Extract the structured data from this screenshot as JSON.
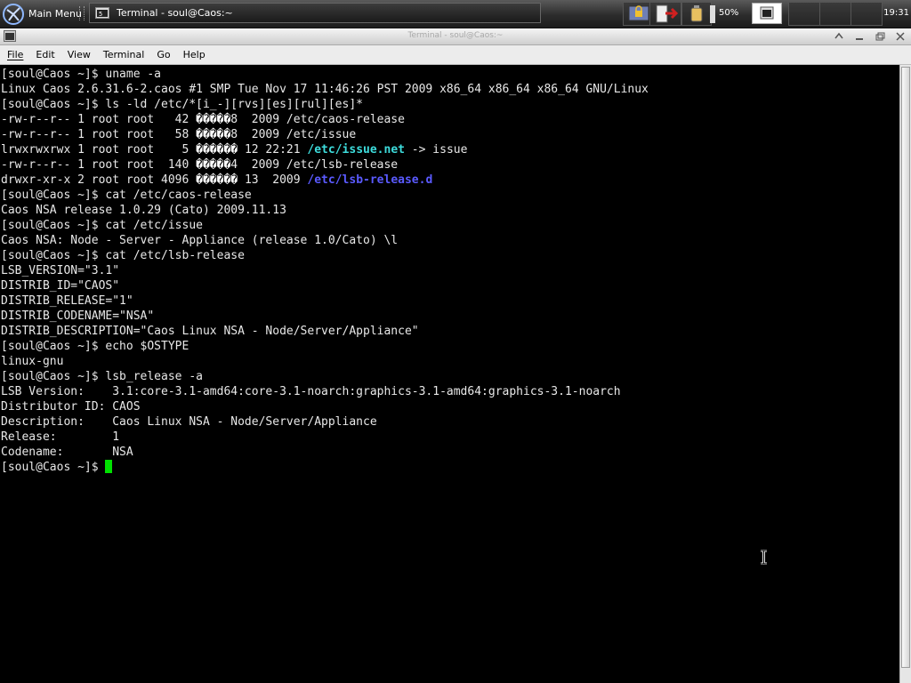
{
  "panel": {
    "main_menu_label": "Main Menu",
    "task_title": "Terminal - soul@Caos:~",
    "battery_percent": "50%",
    "clock": "19:31",
    "icons": [
      "caos-logo-icon",
      "terminal-icon",
      "lock-icon",
      "exit-icon",
      "battery-icon",
      "terminal-launcher-icon"
    ]
  },
  "window": {
    "title": "Terminal - soul@Caos:~",
    "buttons": [
      "shade",
      "minimize",
      "maximize",
      "close"
    ]
  },
  "menubar": {
    "items": [
      {
        "label": "File",
        "mnemonic": "F"
      },
      {
        "label": "Edit",
        "mnemonic": "E"
      },
      {
        "label": "View",
        "mnemonic": "V"
      },
      {
        "label": "Terminal",
        "mnemonic": "T"
      },
      {
        "label": "Go",
        "mnemonic": "G"
      },
      {
        "label": "Help",
        "mnemonic": "H"
      }
    ]
  },
  "terminal": {
    "colors": {
      "fg": "#e8e8e8",
      "link": "#3ddcdc",
      "dir": "#5a5aff",
      "cursor": "#00e000",
      "bg": "#000000"
    },
    "lines": [
      [
        {
          "t": "[soul@Caos ~]$ uname -a"
        }
      ],
      [
        {
          "t": "Linux Caos 2.6.31.6-2.caos #1 SMP Tue Nov 17 11:46:26 PST 2009 x86_64 x86_64 x86_64 GNU/Linux"
        }
      ],
      [
        {
          "t": "[soul@Caos ~]$ ls -ld /etc/*[i_-][rvs][es][rul][es]*"
        }
      ],
      [
        {
          "t": "-rw-r--r-- 1 root root   42 "
        },
        {
          "t": "�����",
          "c": "bad"
        },
        {
          "t": "8  2009 /etc/caos-release"
        }
      ],
      [
        {
          "t": "-rw-r--r-- 1 root root   58 "
        },
        {
          "t": "�����",
          "c": "bad"
        },
        {
          "t": "8  2009 /etc/issue"
        }
      ],
      [
        {
          "t": "lrwxrwxrwx 1 root root    5 "
        },
        {
          "t": "������",
          "c": "bad"
        },
        {
          "t": " 12 22:21 "
        },
        {
          "t": "/etc/issue.net",
          "c": "link"
        },
        {
          "t": " -> issue"
        }
      ],
      [
        {
          "t": "-rw-r--r-- 1 root root  140 "
        },
        {
          "t": "�����",
          "c": "bad"
        },
        {
          "t": "4  2009 /etc/lsb-release"
        }
      ],
      [
        {
          "t": "drwxr-xr-x 2 root root 4096 "
        },
        {
          "t": "������",
          "c": "bad"
        },
        {
          "t": " 13  2009 "
        },
        {
          "t": "/etc/lsb-release.d",
          "c": "dir"
        }
      ],
      [
        {
          "t": "[soul@Caos ~]$ cat /etc/caos-release"
        }
      ],
      [
        {
          "t": "Caos NSA release 1.0.29 (Cato) 2009.11.13"
        }
      ],
      [
        {
          "t": "[soul@Caos ~]$ cat /etc/issue"
        }
      ],
      [
        {
          "t": "Caos NSA: Node - Server - Appliance (release 1.0/Cato) \\l"
        }
      ],
      [
        {
          "t": "[soul@Caos ~]$ cat /etc/lsb-release"
        }
      ],
      [
        {
          "t": "LSB_VERSION=\"3.1\""
        }
      ],
      [
        {
          "t": "DISTRIB_ID=\"CAOS\""
        }
      ],
      [
        {
          "t": "DISTRIB_RELEASE=\"1\""
        }
      ],
      [
        {
          "t": "DISTRIB_CODENAME=\"NSA\""
        }
      ],
      [
        {
          "t": "DISTRIB_DESCRIPTION=\"Caos Linux NSA - Node/Server/Appliance\""
        }
      ],
      [
        {
          "t": "[soul@Caos ~]$ echo $OSTYPE"
        }
      ],
      [
        {
          "t": "linux-gnu"
        }
      ],
      [
        {
          "t": "[soul@Caos ~]$ lsb_release -a"
        }
      ],
      [
        {
          "t": "LSB Version:    3.1:core-3.1-amd64:core-3.1-noarch:graphics-3.1-amd64:graphics-3.1-noarch"
        }
      ],
      [
        {
          "t": "Distributor ID: CAOS"
        }
      ],
      [
        {
          "t": "Description:    Caos Linux NSA - Node/Server/Appliance"
        }
      ],
      [
        {
          "t": "Release:        1"
        }
      ],
      [
        {
          "t": "Codename:       NSA"
        }
      ],
      [
        {
          "t": "[soul@Caos ~]$ "
        },
        {
          "cursor": true
        }
      ]
    ]
  }
}
